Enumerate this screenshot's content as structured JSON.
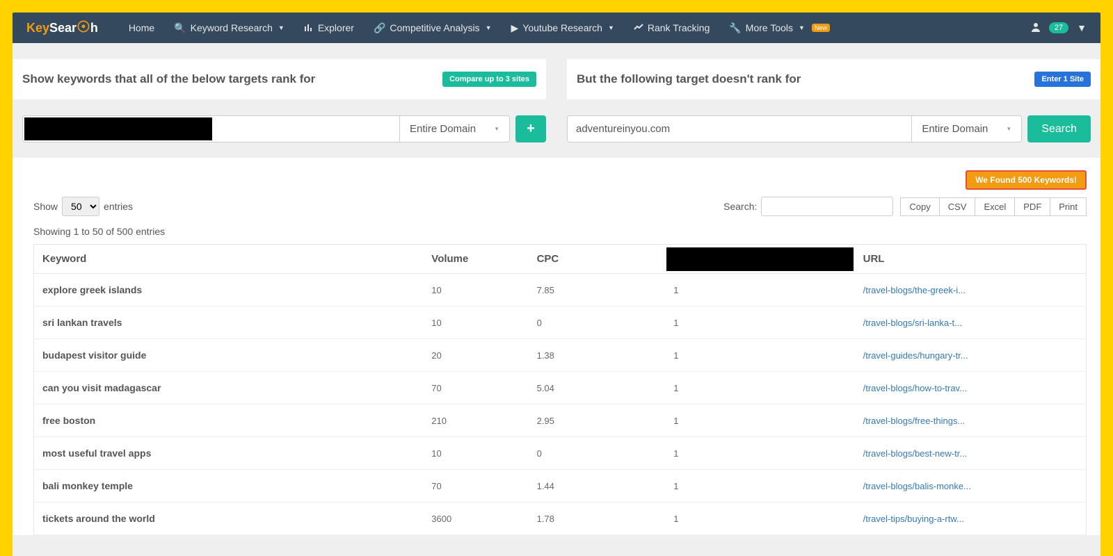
{
  "nav": {
    "home": "Home",
    "keyword_research": "Keyword Research",
    "explorer": "Explorer",
    "competitive_analysis": "Competitive Analysis",
    "youtube_research": "Youtube Research",
    "rank_tracking": "Rank Tracking",
    "more_tools": "More Tools",
    "new_label": "New",
    "notification_count": "27"
  },
  "panel_left": {
    "title": "Show keywords that all of the below targets rank for",
    "badge": "Compare up to 3 sites",
    "domain_scope": "Entire Domain"
  },
  "panel_right": {
    "title": "But the following target doesn't rank for",
    "badge": "Enter 1 Site",
    "input_value": "adventureinyou.com",
    "domain_scope": "Entire Domain",
    "search_label": "Search"
  },
  "results": {
    "found_text": "We Found 500 Keywords!",
    "show_label": "Show",
    "entries_label": "entries",
    "page_size": "50",
    "search_label": "Search:",
    "export": {
      "copy": "Copy",
      "csv": "CSV",
      "excel": "Excel",
      "pdf": "PDF",
      "print": "Print"
    },
    "showing_text": "Showing 1 to 50 of 500 entries",
    "columns": {
      "keyword": "Keyword",
      "volume": "Volume",
      "cpc": "CPC",
      "url": "URL"
    },
    "rows": [
      {
        "keyword": "explore greek islands",
        "volume": "10",
        "cpc": "7.85",
        "rank": "1",
        "url": "/travel-blogs/the-greek-i..."
      },
      {
        "keyword": "sri lankan travels",
        "volume": "10",
        "cpc": "0",
        "rank": "1",
        "url": "/travel-blogs/sri-lanka-t..."
      },
      {
        "keyword": "budapest visitor guide",
        "volume": "20",
        "cpc": "1.38",
        "rank": "1",
        "url": "/travel-guides/hungary-tr..."
      },
      {
        "keyword": "can you visit madagascar",
        "volume": "70",
        "cpc": "5.04",
        "rank": "1",
        "url": "/travel-blogs/how-to-trav..."
      },
      {
        "keyword": "free boston",
        "volume": "210",
        "cpc": "2.95",
        "rank": "1",
        "url": "/travel-blogs/free-things..."
      },
      {
        "keyword": "most useful travel apps",
        "volume": "10",
        "cpc": "0",
        "rank": "1",
        "url": "/travel-blogs/best-new-tr..."
      },
      {
        "keyword": "bali monkey temple",
        "volume": "70",
        "cpc": "1.44",
        "rank": "1",
        "url": "/travel-blogs/balis-monke..."
      },
      {
        "keyword": "tickets around the world",
        "volume": "3600",
        "cpc": "1.78",
        "rank": "1",
        "url": "/travel-tips/buying-a-rtw..."
      }
    ]
  }
}
